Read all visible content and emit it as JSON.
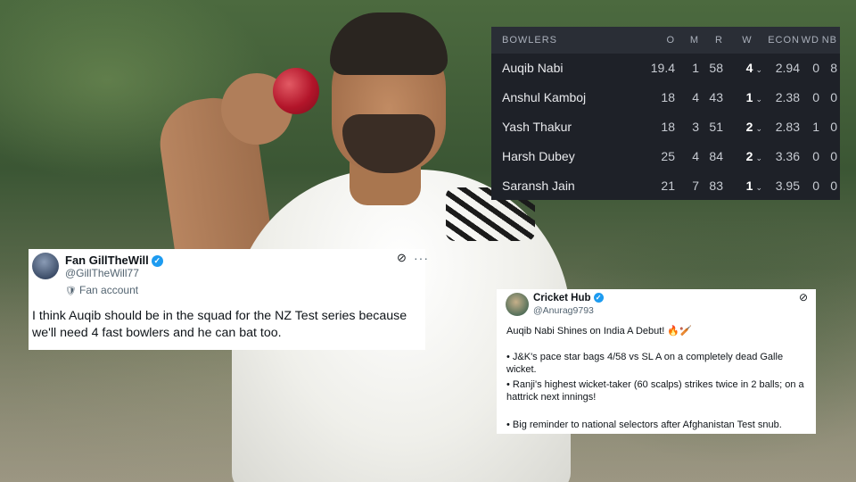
{
  "scorecard": {
    "headers": {
      "bowlers": "BOWLERS",
      "o": "O",
      "m": "M",
      "r": "R",
      "w": "W",
      "econ": "ECON",
      "wd": "WD",
      "nb": "NB"
    },
    "rows": [
      {
        "name": "Auqib Nabi",
        "o": "19.4",
        "m": "1",
        "r": "58",
        "w": "4",
        "econ": "2.94",
        "wd": "0",
        "nb": "8"
      },
      {
        "name": "Anshul Kamboj",
        "o": "18",
        "m": "4",
        "r": "43",
        "w": "1",
        "econ": "2.38",
        "wd": "0",
        "nb": "0"
      },
      {
        "name": "Yash Thakur",
        "o": "18",
        "m": "3",
        "r": "51",
        "w": "2",
        "econ": "2.83",
        "wd": "1",
        "nb": "0"
      },
      {
        "name": "Harsh Dubey",
        "o": "25",
        "m": "4",
        "r": "84",
        "w": "2",
        "econ": "3.36",
        "wd": "0",
        "nb": "0"
      },
      {
        "name": "Saransh Jain",
        "o": "21",
        "m": "7",
        "r": "83",
        "w": "1",
        "econ": "3.95",
        "wd": "0",
        "nb": "0"
      }
    ],
    "colors": {
      "bg": "#1e2128",
      "header_bg": "#2a2e36"
    }
  },
  "tweet1": {
    "name": "Fan GillTheWill",
    "handle": "@GillTheWill77",
    "label": "Fan account",
    "text": "I think Auqib should be in the squad for the NZ Test series because we'll need 4 fast bowlers and he can bat too."
  },
  "tweet2": {
    "name": "Cricket Hub",
    "handle": "@Anurag9793",
    "lines": [
      "Auqib Nabi Shines on India A Debut! 🔥🏏",
      "• J&K's pace star bags 4/58 vs SL A on a completely dead Galle wicket.",
      "• Ranji's highest wicket-taker (60 scalps) strikes twice in 2 balls; on a hattrick next innings!",
      "• Big reminder to national selectors after Afghanistan Test snub."
    ]
  },
  "icons": {
    "verified": "✓",
    "grok": "⊘",
    "more": "···",
    "chevron": "⌄",
    "fan_badge": "🛡"
  },
  "colors": {
    "verified": "#1d9bf0",
    "handle": "#536471"
  }
}
